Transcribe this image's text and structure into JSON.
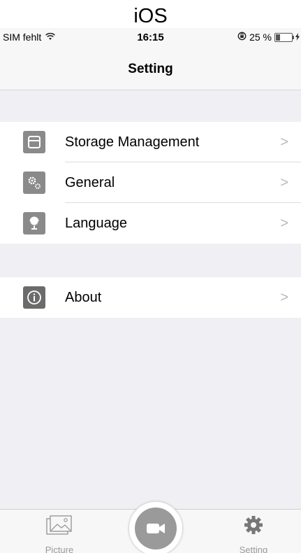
{
  "caption": "iOS",
  "status_bar": {
    "carrier": "SIM fehlt",
    "wifi_icon": "wifi-icon",
    "time": "16:15",
    "battery_percent": "25 %",
    "battery_level": 0.25
  },
  "nav": {
    "title": "Setting"
  },
  "groups": [
    {
      "items": [
        {
          "label": "Storage Management",
          "icon": "storage-icon"
        },
        {
          "label": "General",
          "icon": "gears-icon"
        },
        {
          "label": "Language",
          "icon": "globe-icon"
        }
      ]
    },
    {
      "items": [
        {
          "label": "About",
          "icon": "info-icon"
        }
      ]
    }
  ],
  "chevron": ">",
  "tab_bar": {
    "left_label": "Picture",
    "right_label": "Setting",
    "center_icon": "video-camera-icon"
  },
  "colors": {
    "background": "#efeff4",
    "icon_gray": "#8a8a8a",
    "icon_dark": "#6b6b6b",
    "tab_gray": "#999999"
  }
}
